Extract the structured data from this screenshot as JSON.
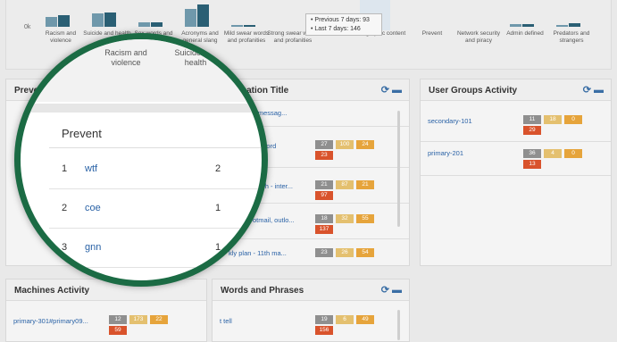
{
  "chart": {
    "ylabel": "0k",
    "categories": [
      "Racism and violence",
      "Suicide and health",
      "Sex words and slang",
      "Acronyms and general slang",
      "Mild swear words and profanities",
      "Strong swear words and profanities",
      "addiction",
      "graphic content",
      "Prevent",
      "Network security and piracy",
      "Admin defined",
      "Predators and strangers"
    ],
    "series": [
      {
        "name": "Previous 7 days",
        "values": [
          11,
          15,
          5,
          20,
          2,
          0,
          0,
          0,
          0,
          0,
          3,
          2
        ],
        "color": "#6f98ab"
      },
      {
        "name": "Last 7 days",
        "values": [
          13,
          16,
          5,
          25,
          2,
          0,
          0,
          0,
          0,
          0,
          3,
          4
        ],
        "color": "#2a5f74"
      }
    ]
  },
  "tooltip": {
    "line1": "• Previous 7 days: 93",
    "line2": "• Last 7 days: 146"
  },
  "prevent_panel": {
    "title": "Prevent",
    "rows": [
      {
        "rank": "1",
        "word": "wtf",
        "count": "2"
      },
      {
        "rank": "2",
        "word": "coe",
        "count": "1"
      },
      {
        "rank": "3",
        "word": "gnn",
        "count": "1"
      }
    ]
  },
  "magnifier": {
    "cat1": "Racism and violence",
    "cat2": "Suicide and health"
  },
  "application_panel": {
    "title": "lication Title",
    "rows": [
      {
        "name": "n - messag...",
        "b1": "",
        "b2": "",
        "b3": "",
        "b4": ""
      },
      {
        "name": "word",
        "b1": "27",
        "b2": "100",
        "b3": "24",
        "b4": "23"
      },
      {
        "name": "ch - inter...",
        "b1": "21",
        "b2": "87",
        "b3": "21",
        "b4": "97"
      },
      {
        "name": "otmail, outlo...",
        "b1": "18",
        "b2": "32",
        "b3": "55",
        "b4": "137"
      },
      {
        "name": "kly plan - 11th ma...",
        "b1": "23",
        "b2": "26",
        "b3": "54",
        "b4": ""
      }
    ]
  },
  "user_groups_panel": {
    "title": "User Groups Activity",
    "rows": [
      {
        "name": "secondary-101",
        "b1": "11",
        "b2": "18",
        "b3": "0",
        "b4": "29"
      },
      {
        "name": "primary-201",
        "b1": "36",
        "b2": "4",
        "b3": "0",
        "b4": "13"
      }
    ]
  },
  "machines_panel": {
    "title": "Machines Activity",
    "rows": [
      {
        "name": "primary-301#primary09...",
        "b1": "12",
        "b2": "173",
        "b3": "22",
        "b4": "59"
      }
    ]
  },
  "words_panel": {
    "title": "Words and Phrases",
    "rows": [
      {
        "name": "t tell",
        "b1": "19",
        "b2": "6",
        "b3": "49",
        "b4": "156"
      }
    ]
  },
  "icons": {
    "refresh": "refresh-icon",
    "collapse": "minus-icon"
  }
}
